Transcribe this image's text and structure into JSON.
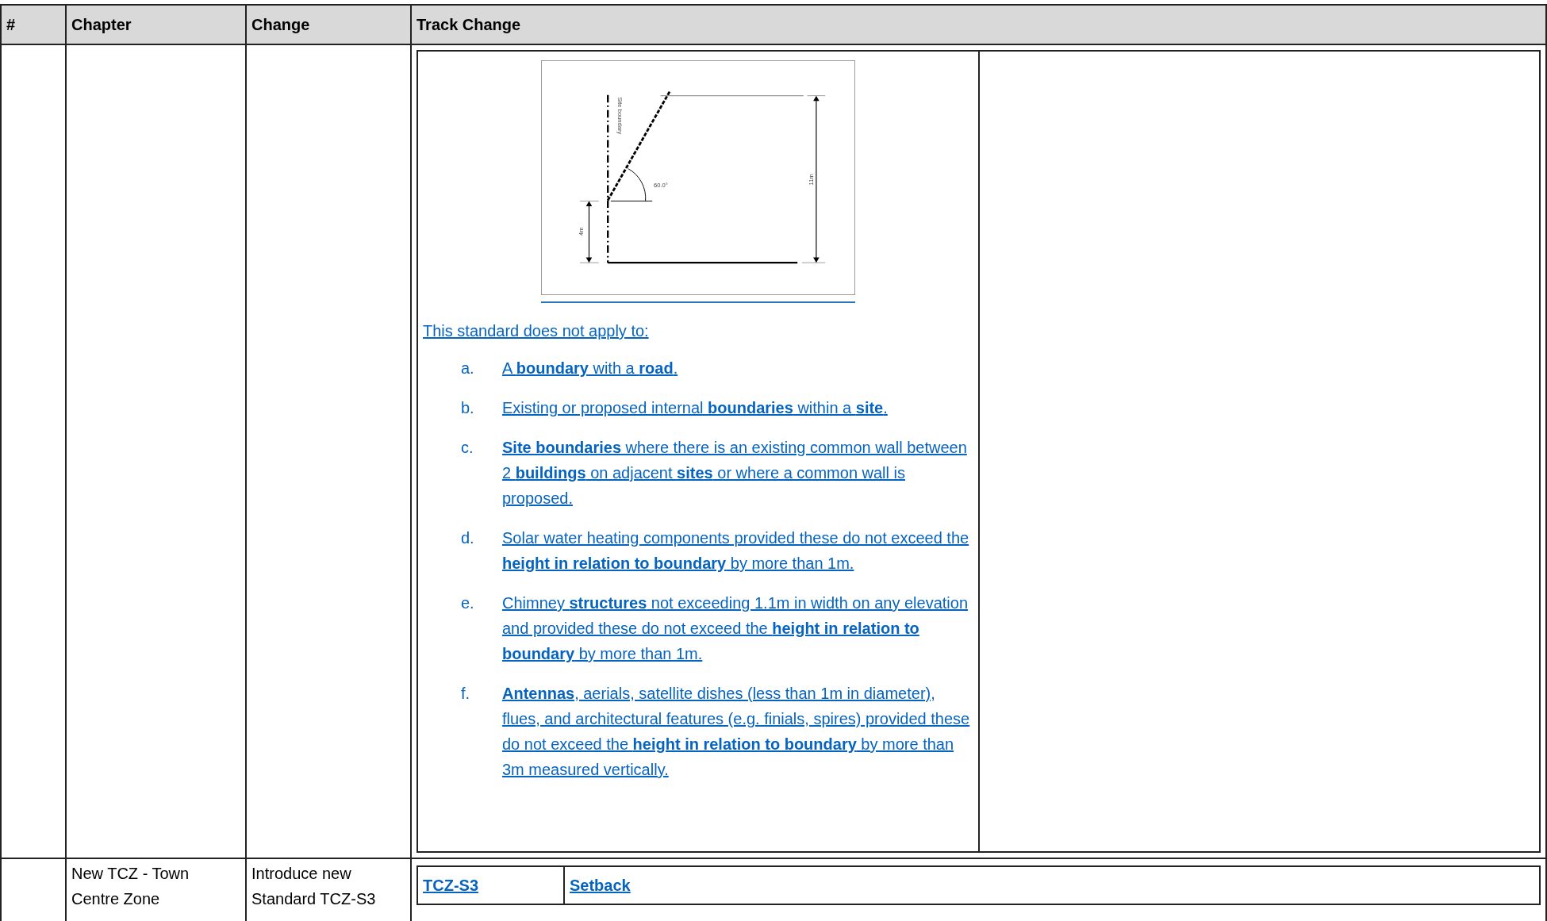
{
  "table": {
    "columns": [
      "#",
      "Chapter",
      "Change",
      "Track Change"
    ],
    "rows": [
      {
        "kind": "standard_body",
        "diagram": {
          "boundary_label": "Site boundary",
          "angle_label": "60.0°",
          "height_label": "11m",
          "base_label": "4m"
        },
        "intro": "This standard does not apply to:",
        "items": [
          {
            "letter": "a.",
            "text": "A **boundary** with a **road**."
          },
          {
            "letter": "b.",
            "text": "Existing or proposed internal **boundaries** within a **site**."
          },
          {
            "letter": "c.",
            "text": "**Site boundaries** where there is an existing common wall between 2 **buildings** on adjacent **sites** or where a common wall is proposed."
          },
          {
            "letter": "d.",
            "text": "Solar water heating components provided these do not exceed the **height in relation to boundary** by more than 1m."
          },
          {
            "letter": "e.",
            "text": "Chimney **structures** not exceeding 1.1m in width on any elevation and provided these do not exceed the **height in relation to boundary** by more than 1m."
          },
          {
            "letter": "f.",
            "text": "**Antennas**, aerials, satellite dishes (less than 1m in diameter), flues, and architectural features (e.g. finials, spires) provided these do not exceed the **height in relation to boundary** by more than 3m measured vertically."
          }
        ]
      },
      {
        "kind": "standard_heading",
        "chapter": "New TCZ - Town Centre Zone",
        "change": "Introduce new Standard TCZ-S3",
        "code": "TCZ-S3",
        "title": "Setback"
      }
    ]
  }
}
